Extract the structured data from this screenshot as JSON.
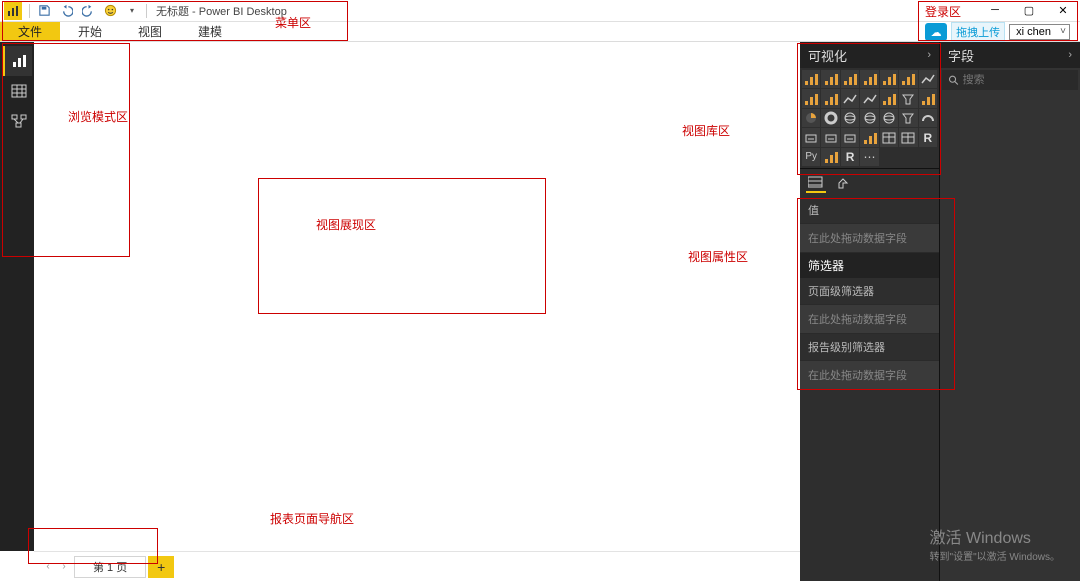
{
  "titlebar": {
    "title": "无标题 - Power BI Desktop"
  },
  "menubar": {
    "file": "文件",
    "home": "开始",
    "view": "视图",
    "modeling": "建模"
  },
  "signin": {
    "upload_hint": "拖拽上传",
    "user": "xi chen"
  },
  "annotations": {
    "menu_area": "菜单区",
    "signin_area": "登录区",
    "viewmode_area": "浏览模式区",
    "canvas_area": "视图展现区",
    "vizlib_area": "视图库区",
    "vizprops_area": "视图属性区",
    "pagetabs_area": "报表页面导航区"
  },
  "panes": {
    "viz_title": "可视化",
    "fields_title": "字段",
    "search_placeholder": "搜索",
    "values_label": "值",
    "drop_fields_hint": "在此处拖动数据字段",
    "filters_header": "筛选器",
    "page_filter_label": "页面级筛选器",
    "report_filter_label": "报告级别筛选器"
  },
  "pagetabs": {
    "page1": "第 1 页"
  },
  "watermark": {
    "line1": "激活 Windows",
    "line2": "转到\"设置\"以激活 Windows。"
  },
  "viz_icons": [
    "stacked-bar",
    "stacked-column",
    "clustered-bar",
    "clustered-column",
    "100-stacked-bar",
    "100-stacked-column",
    "line",
    "area",
    "stacked-area",
    "line-stacked-column",
    "line-clustered-column",
    "ribbon",
    "waterfall",
    "scatter",
    "pie",
    "donut",
    "treemap",
    "map",
    "filled-map",
    "funnel",
    "gauge",
    "card",
    "multi-row-card",
    "kpi",
    "slicer",
    "table",
    "matrix",
    "r-visual",
    "python",
    "arcgis",
    "r-script",
    "more"
  ]
}
